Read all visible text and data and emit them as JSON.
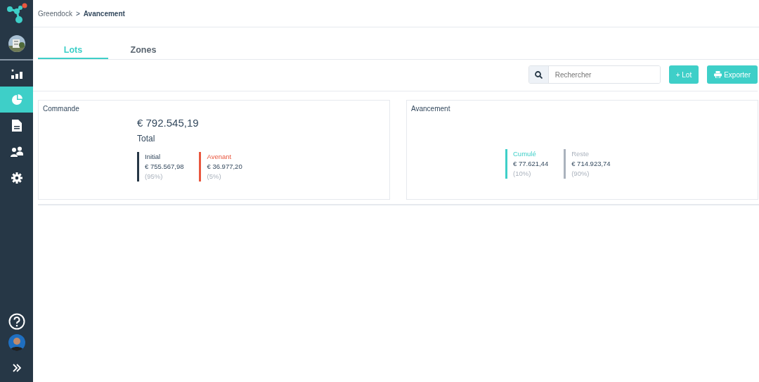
{
  "breadcrumb": {
    "parent": "Greendock",
    "separator": ">",
    "current": "Avancement"
  },
  "sidebar": {
    "items": [
      {
        "kind": "chart",
        "selected": false
      },
      {
        "kind": "pie",
        "selected": true
      },
      {
        "kind": "document",
        "selected": false
      },
      {
        "kind": "people",
        "selected": false
      },
      {
        "kind": "gear",
        "selected": false
      }
    ]
  },
  "tabs": [
    {
      "label": "Lots",
      "selected": true
    },
    {
      "label": "Zones",
      "selected": false
    }
  ],
  "search": {
    "placeholder": "Rechercher"
  },
  "buttons": [
    {
      "label": "+ Lot",
      "kind": "add"
    },
    {
      "label": "Exporter",
      "kind": "print"
    }
  ],
  "cards": [
    {
      "title": "Commande",
      "total": "€ 792.545,19",
      "total_label": "Total",
      "legend": [
        {
          "label": "Initial",
          "value": "€ 755.567,98",
          "percent": "(95%)",
          "color": "#263746"
        },
        {
          "label": "Avenant",
          "value": "€ 36.977,20",
          "percent": "(5%)",
          "color": "#e9573f"
        }
      ]
    },
    {
      "title": "Avancement",
      "legend": [
        {
          "label": "Cumulé",
          "value": "€ 77.621,44",
          "percent": "(10%)",
          "color": "#3ecfc8"
        },
        {
          "label": "Reste",
          "value": "€ 714.923,74",
          "percent": "(90%)",
          "color": "#aab2bd"
        }
      ]
    }
  ]
}
